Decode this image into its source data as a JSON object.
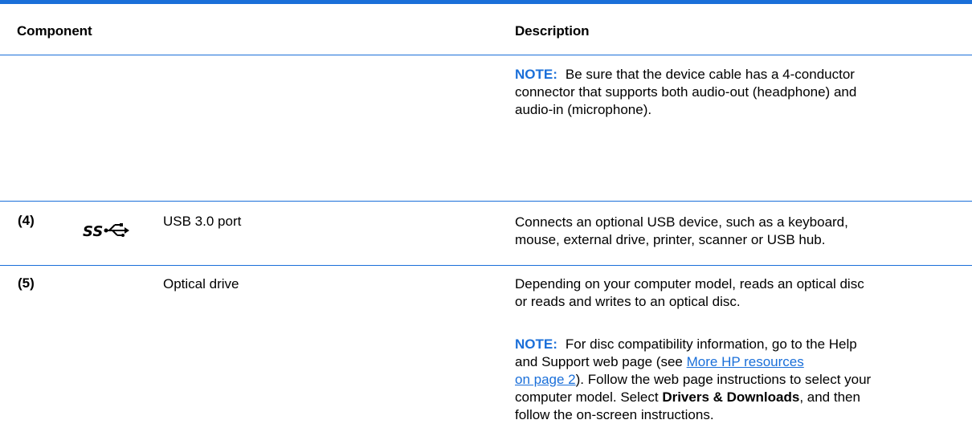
{
  "header": {
    "component": "Component",
    "description": "Description"
  },
  "row3_note": {
    "label": "NOTE:",
    "line1": "Be sure that the device cable has a 4-conductor",
    "line2": "connector that supports both audio-out (headphone) and",
    "line3": "audio-in (microphone)."
  },
  "row4": {
    "number": "(4)",
    "icon": "usb-superspeed-icon",
    "component": "USB 3.0 port",
    "desc_line1": "Connects an optional USB device, such as a keyboard,",
    "desc_line2": "mouse, external drive, printer, scanner or USB hub."
  },
  "row5": {
    "number": "(5)",
    "component": "Optical drive",
    "desc_line1": "Depending on your computer model, reads an optical disc",
    "desc_line2": "or reads and writes to an optical disc.",
    "note_label": "NOTE:",
    "note_line1": "For disc compatibility information, go to the Help",
    "note_line2_pre": "and Support web page (see ",
    "note_link_line1": "More HP resources",
    "note_link_line2": "on page 2",
    "note_line3_post": "). Follow the web page instructions to select your",
    "note_line4_pre": "computer model. Select ",
    "note_line4_bold": "Drivers & Downloads",
    "note_line4_post": ", and then",
    "note_line5": "follow the on-screen instructions."
  }
}
